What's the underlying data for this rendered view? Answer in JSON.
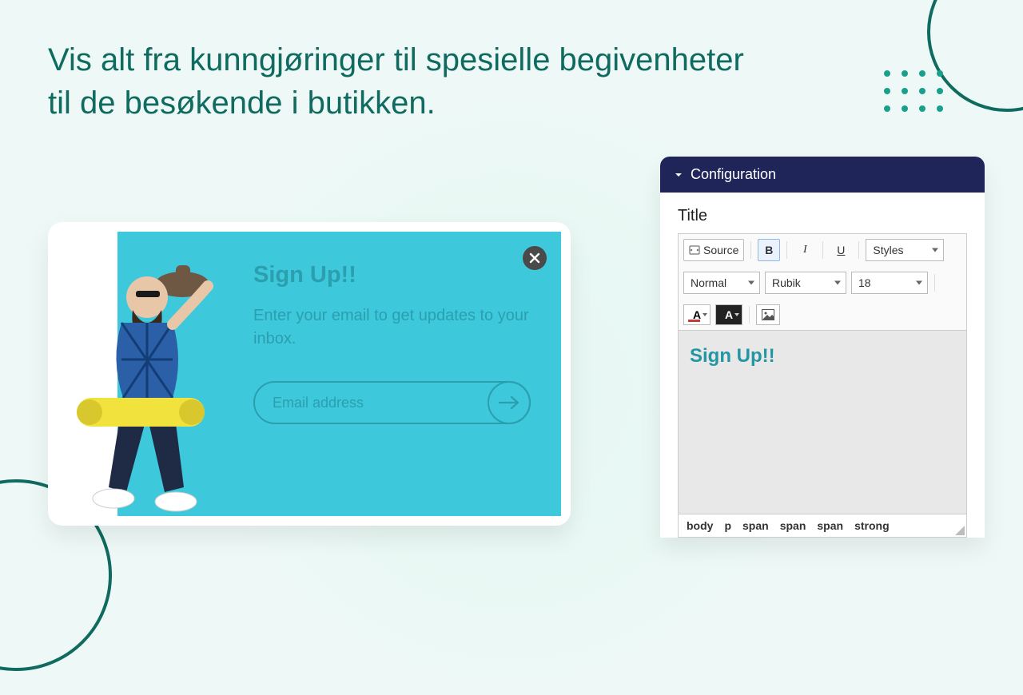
{
  "headline": {
    "line1": "Vis alt fra kunngjøringer til spesielle begivenheter",
    "line2": "til de besøkende i butikken."
  },
  "popup": {
    "title": "Sign Up!!",
    "subtitle": "Enter your email to get updates to your inbox.",
    "email_placeholder": "Email address"
  },
  "config": {
    "header": "Configuration",
    "title_label": "Title",
    "toolbar": {
      "source": "Source",
      "styles": "Styles",
      "format": "Normal",
      "font": "Rubik",
      "size": "18"
    },
    "editor_preview": "Sign Up!!",
    "breadcrumb": [
      "body",
      "p",
      "span",
      "span",
      "span",
      "strong"
    ]
  }
}
